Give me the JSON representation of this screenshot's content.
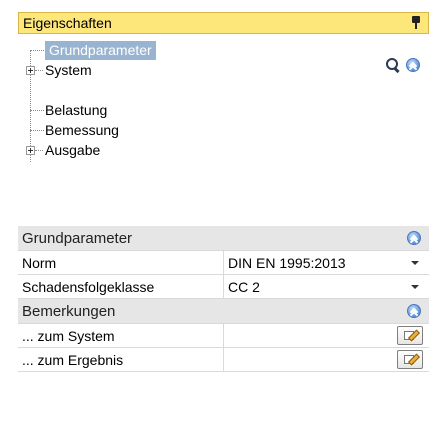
{
  "panel": {
    "title": "Eigenschaften"
  },
  "tree": {
    "items": [
      {
        "label": "Grundparameter",
        "selected": true,
        "expandable": false
      },
      {
        "label": "System",
        "selected": false,
        "expandable": true
      },
      {
        "label": "Belastung",
        "selected": false,
        "expandable": false
      },
      {
        "label": "Bemessung",
        "selected": false,
        "expandable": false
      },
      {
        "label": "Ausgabe",
        "selected": false,
        "expandable": true
      }
    ]
  },
  "sections": [
    {
      "title": "Grundparameter",
      "rows": [
        {
          "label": "Norm",
          "value": "DIN EN 1995:2013",
          "control": "dropdown"
        },
        {
          "label": "Schadensfolgeklasse",
          "value": "CC 2",
          "control": "dropdown"
        }
      ]
    },
    {
      "title": "Bemerkungen",
      "rows": [
        {
          "label": "... zum System",
          "value": "",
          "control": "edit-button"
        },
        {
          "label": "... zum Ergebnis",
          "value": "",
          "control": "edit-button"
        }
      ]
    }
  ],
  "colors": {
    "header_bg": "#fde67a",
    "selection_bg": "#99b4d1",
    "section_bg": "#e6e6e6"
  },
  "icons": [
    "pin-icon",
    "search-icon",
    "collapse-icon",
    "expand-icon",
    "edit-icon"
  ]
}
